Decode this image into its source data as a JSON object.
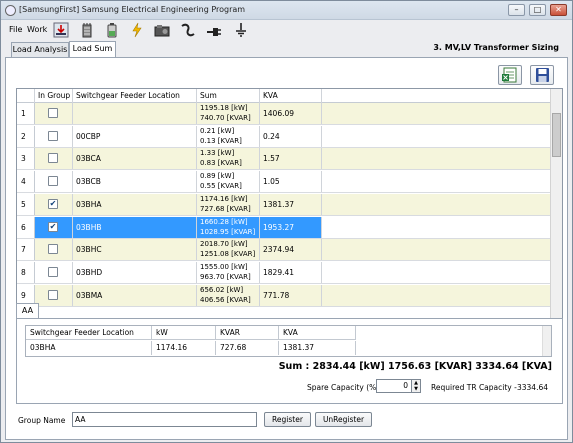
{
  "window": {
    "title": "[SamsungFirst] Samsung Electrical Engineering Program",
    "minimize": "–",
    "maximize": "□",
    "close": "✕"
  },
  "menu": {
    "file": "File",
    "work": "Work"
  },
  "toolbar": [
    "download-icon",
    "transformer-icon",
    "battery-icon",
    "lightning-icon",
    "generator-icon",
    "cable-icon",
    "plug-icon",
    "ground-icon"
  ],
  "tabs": [
    "Load Analysis",
    "Load Sum"
  ],
  "section_title": "3. MV,LV Transformer Sizing",
  "grid": {
    "headers": {
      "in_group": "In Group",
      "location": "Switchgear Feeder Location",
      "sum": "Sum",
      "kva": "KVA"
    },
    "rows": [
      {
        "n": "1",
        "checked": false,
        "loc": "",
        "kw": "1195.18 [kW]",
        "kvar": "740.70 [KVAR]",
        "kva": "1406.09"
      },
      {
        "n": "2",
        "checked": false,
        "loc": "00CBP",
        "kw": "0.21 [kW]",
        "kvar": "0.13 [KVAR]",
        "kva": "0.24"
      },
      {
        "n": "3",
        "checked": false,
        "loc": "03BCA",
        "kw": "1.33 [kW]",
        "kvar": "0.83 [KVAR]",
        "kva": "1.57"
      },
      {
        "n": "4",
        "checked": false,
        "loc": "03BCB",
        "kw": "0.89 [kW]",
        "kvar": "0.55 [KVAR]",
        "kva": "1.05"
      },
      {
        "n": "5",
        "checked": true,
        "loc": "03BHA",
        "kw": "1174.16 [kW]",
        "kvar": "727.68 [KVAR]",
        "kva": "1381.37"
      },
      {
        "n": "6",
        "checked": true,
        "loc": "03BHB",
        "kw": "1660.28 [kW]",
        "kvar": "1028.95 [KVAR]",
        "kva": "1953.27",
        "selected": true
      },
      {
        "n": "7",
        "checked": false,
        "loc": "03BHC",
        "kw": "2018.70 [kW]",
        "kvar": "1251.08 [KVAR]",
        "kva": "2374.94"
      },
      {
        "n": "8",
        "checked": false,
        "loc": "03BHD",
        "kw": "1555.00 [kW]",
        "kvar": "963.70 [KVAR]",
        "kva": "1829.41"
      },
      {
        "n": "9",
        "checked": false,
        "loc": "03BMA",
        "kw": "656.02 [kW]",
        "kvar": "406.56 [KVAR]",
        "kva": "771.78"
      }
    ]
  },
  "group": {
    "tab": "AA",
    "headers": {
      "location": "Switchgear Feeder Location",
      "kw": "kW",
      "kvar": "KVAR",
      "kva": "KVA"
    },
    "rows": [
      {
        "loc": "03BHA",
        "kw": "1174.16",
        "kvar": "727.68",
        "kva": "1381.37"
      }
    ],
    "sum": "Sum : 2834.44 [kW] 1756.63 [KVAR] 3334.64 [KVA]",
    "spare_label": "Spare Capacity (%)",
    "spare_value": "0",
    "required_label": "Required TR Capacity -",
    "required_value": "3334.64"
  },
  "footer": {
    "group_name_label": "Group Name",
    "group_name_value": "AA",
    "register": "Register",
    "unregister": "UnRegister"
  },
  "colors": {
    "row_alt": "#f5f5dc",
    "selected": "#3399ff"
  }
}
